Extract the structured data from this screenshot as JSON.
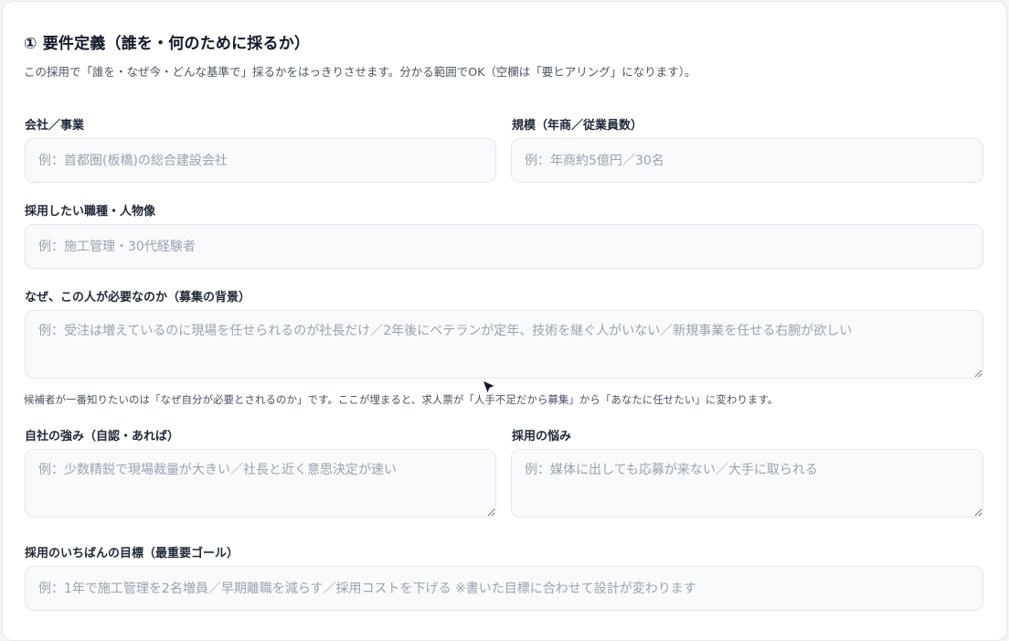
{
  "section": {
    "title": "① 要件定義（誰を・何のために採るか）",
    "description": "この採用で「誰を・なぜ今・どんな基準で」採るかをはっきりさせます。分かる範囲でOK（空欄は「要ヒアリング」になります）。"
  },
  "fields": {
    "company": {
      "label": "会社／事業",
      "value": "",
      "placeholder": "例：首都圏(板橋)の総合建設会社"
    },
    "scale": {
      "label": "規模（年商／従業員数）",
      "value": "",
      "placeholder": "例：年商約5億円／30名"
    },
    "role": {
      "label": "採用したい職種・人物像",
      "value": "",
      "placeholder": "例：施工管理・30代経験者"
    },
    "background": {
      "label": "なぜ、この人が必要なのか（募集の背景）",
      "value": "",
      "placeholder": "例：受注は増えているのに現場を任せられるのが社長だけ／2年後にベテランが定年、技術を継ぐ人がいない／新規事業を任せる右腕が欲しい",
      "hint": "候補者が一番知りたいのは「なぜ自分が必要とされるのか」です。ここが埋まると、求人票が「人手不足だから募集」から「あなたに任せたい」に変わります。"
    },
    "strengths": {
      "label": "自社の強み（自認・あれば）",
      "value": "",
      "placeholder": "例：少数精鋭で現場裁量が大きい／社長と近く意思決定が速い"
    },
    "concerns": {
      "label": "採用の悩み",
      "value": "",
      "placeholder": "例：媒体に出しても応募が来ない／大手に取られる"
    },
    "goal": {
      "label": "採用のいちばんの目標（最重要ゴール）",
      "value": "",
      "placeholder": "例：1年で施工管理を2名増員／早期離職を減らす／採用コストを下げる ※書いた目標に合わせて設計が変わります"
    }
  }
}
